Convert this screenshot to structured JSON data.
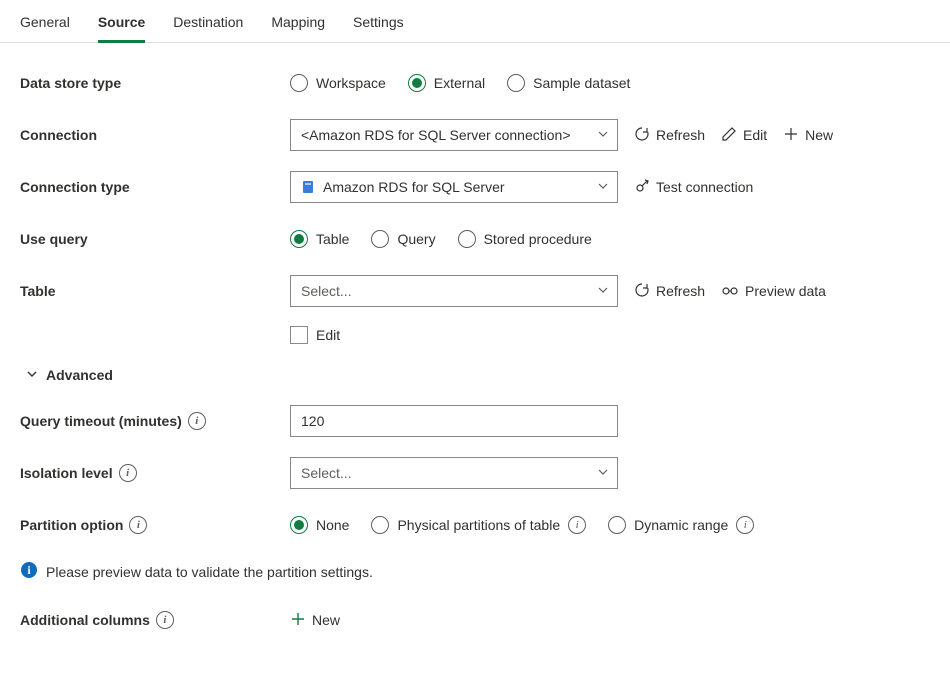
{
  "tabs": {
    "general": "General",
    "source": "Source",
    "destination": "Destination",
    "mapping": "Mapping",
    "settings": "Settings",
    "active": "source"
  },
  "labels": {
    "dataStoreType": "Data store type",
    "connection": "Connection",
    "connectionType": "Connection type",
    "useQuery": "Use query",
    "table": "Table",
    "edit": "Edit",
    "advanced": "Advanced",
    "queryTimeout": "Query timeout (minutes)",
    "isolationLevel": "Isolation level",
    "partitionOption": "Partition option",
    "additionalColumns": "Additional columns"
  },
  "dataStoreType": {
    "options": {
      "workspace": "Workspace",
      "external": "External",
      "sample": "Sample dataset"
    },
    "selected": "external"
  },
  "connection": {
    "value": "<Amazon RDS for SQL Server connection>",
    "actions": {
      "refresh": "Refresh",
      "edit": "Edit",
      "new": "New"
    }
  },
  "connectionType": {
    "value": "Amazon RDS for SQL Server",
    "action": "Test connection"
  },
  "useQuery": {
    "options": {
      "table": "Table",
      "query": "Query",
      "sp": "Stored procedure"
    },
    "selected": "table"
  },
  "table": {
    "placeholder": "Select...",
    "actions": {
      "refresh": "Refresh",
      "preview": "Preview data"
    },
    "editCheckbox": false
  },
  "queryTimeout": {
    "value": "120"
  },
  "isolationLevel": {
    "placeholder": "Select..."
  },
  "partitionOption": {
    "options": {
      "none": "None",
      "physical": "Physical partitions of table",
      "dynamic": "Dynamic range"
    },
    "selected": "none"
  },
  "infoMessage": "Please preview data to validate the partition settings.",
  "additionalColumns": {
    "newLabel": "New"
  }
}
